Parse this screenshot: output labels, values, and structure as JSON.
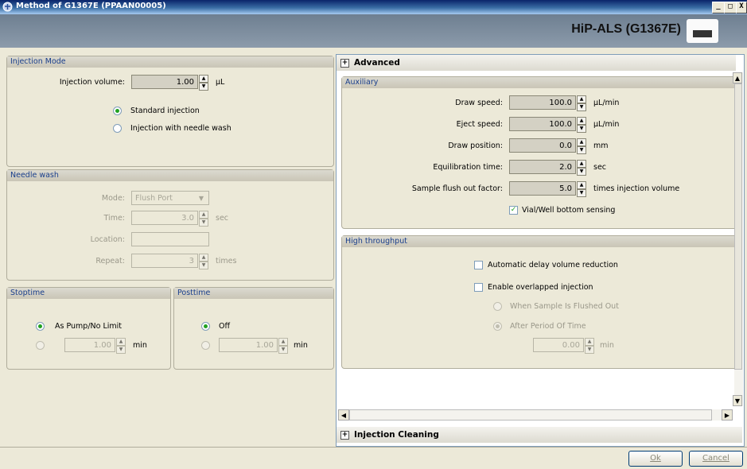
{
  "window": {
    "title": "Method of G1367E (PPAAN00005)",
    "buttons": {
      "minimize": "_",
      "maximize": "□",
      "close": "X"
    }
  },
  "header": {
    "module_name": "HiP-ALS (G1367E)"
  },
  "injection_mode": {
    "header": "Injection Mode",
    "volume_label": "Injection volume:",
    "volume_value": "1.00",
    "volume_unit": "µL",
    "options": [
      {
        "label": "Standard injection",
        "selected": true
      },
      {
        "label": "Injection with needle wash",
        "selected": false
      }
    ]
  },
  "needle_wash": {
    "header": "Needle wash",
    "mode_label": "Mode:",
    "mode_value": "Flush Port",
    "time_label": "Time:",
    "time_value": "3.0",
    "time_unit": "sec",
    "location_label": "Location:",
    "location_value": "",
    "repeat_label": "Repeat:",
    "repeat_value": "3",
    "repeat_unit": "times"
  },
  "stoptime": {
    "header": "Stoptime",
    "option1": "As Pump/No Limit",
    "value": "1.00",
    "unit": "min"
  },
  "posttime": {
    "header": "Posttime",
    "option1": "Off",
    "value": "1.00",
    "unit": "min"
  },
  "advanced": {
    "header": "Advanced",
    "auxiliary": {
      "header": "Auxiliary",
      "rows": [
        {
          "label": "Draw speed:",
          "value": "100.0",
          "unit": "µL/min"
        },
        {
          "label": "Eject speed:",
          "value": "100.0",
          "unit": "µL/min"
        },
        {
          "label": "Draw position:",
          "value": "0.0",
          "unit": "mm"
        },
        {
          "label": "Equilibration time:",
          "value": "2.0",
          "unit": "sec"
        },
        {
          "label": "Sample flush out factor:",
          "value": "5.0",
          "unit": "times injection volume"
        }
      ],
      "vial_sensing_label": "Vial/Well bottom sensing",
      "vial_sensing_checked": true
    },
    "high_throughput": {
      "header": "High throughput",
      "auto_delay_label": "Automatic delay volume reduction",
      "auto_delay_checked": false,
      "overlapped_label": "Enable overlapped injection",
      "overlapped_checked": false,
      "when_flushed_label": "When Sample Is Flushed Out",
      "after_period_label": "After Period Of Time",
      "period_value": "0.00",
      "period_unit": "min"
    }
  },
  "injection_cleaning": {
    "header": "Injection Cleaning"
  },
  "footer": {
    "ok_label": "Ok",
    "cancel_label": "Cancel"
  }
}
